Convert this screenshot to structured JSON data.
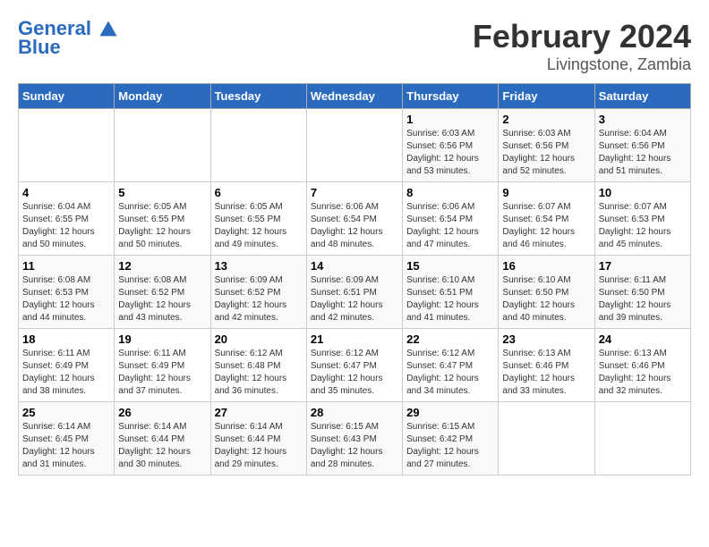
{
  "logo": {
    "line1": "General",
    "line2": "Blue"
  },
  "title": "February 2024",
  "subtitle": "Livingstone, Zambia",
  "header": {
    "days": [
      "Sunday",
      "Monday",
      "Tuesday",
      "Wednesday",
      "Thursday",
      "Friday",
      "Saturday"
    ]
  },
  "weeks": [
    [
      {
        "day": "",
        "sunrise": "",
        "sunset": "",
        "daylight": ""
      },
      {
        "day": "",
        "sunrise": "",
        "sunset": "",
        "daylight": ""
      },
      {
        "day": "",
        "sunrise": "",
        "sunset": "",
        "daylight": ""
      },
      {
        "day": "",
        "sunrise": "",
        "sunset": "",
        "daylight": ""
      },
      {
        "day": "1",
        "sunrise": "Sunrise: 6:03 AM",
        "sunset": "Sunset: 6:56 PM",
        "daylight": "Daylight: 12 hours and 53 minutes."
      },
      {
        "day": "2",
        "sunrise": "Sunrise: 6:03 AM",
        "sunset": "Sunset: 6:56 PM",
        "daylight": "Daylight: 12 hours and 52 minutes."
      },
      {
        "day": "3",
        "sunrise": "Sunrise: 6:04 AM",
        "sunset": "Sunset: 6:56 PM",
        "daylight": "Daylight: 12 hours and 51 minutes."
      }
    ],
    [
      {
        "day": "4",
        "sunrise": "Sunrise: 6:04 AM",
        "sunset": "Sunset: 6:55 PM",
        "daylight": "Daylight: 12 hours and 50 minutes."
      },
      {
        "day": "5",
        "sunrise": "Sunrise: 6:05 AM",
        "sunset": "Sunset: 6:55 PM",
        "daylight": "Daylight: 12 hours and 50 minutes."
      },
      {
        "day": "6",
        "sunrise": "Sunrise: 6:05 AM",
        "sunset": "Sunset: 6:55 PM",
        "daylight": "Daylight: 12 hours and 49 minutes."
      },
      {
        "day": "7",
        "sunrise": "Sunrise: 6:06 AM",
        "sunset": "Sunset: 6:54 PM",
        "daylight": "Daylight: 12 hours and 48 minutes."
      },
      {
        "day": "8",
        "sunrise": "Sunrise: 6:06 AM",
        "sunset": "Sunset: 6:54 PM",
        "daylight": "Daylight: 12 hours and 47 minutes."
      },
      {
        "day": "9",
        "sunrise": "Sunrise: 6:07 AM",
        "sunset": "Sunset: 6:54 PM",
        "daylight": "Daylight: 12 hours and 46 minutes."
      },
      {
        "day": "10",
        "sunrise": "Sunrise: 6:07 AM",
        "sunset": "Sunset: 6:53 PM",
        "daylight": "Daylight: 12 hours and 45 minutes."
      }
    ],
    [
      {
        "day": "11",
        "sunrise": "Sunrise: 6:08 AM",
        "sunset": "Sunset: 6:53 PM",
        "daylight": "Daylight: 12 hours and 44 minutes."
      },
      {
        "day": "12",
        "sunrise": "Sunrise: 6:08 AM",
        "sunset": "Sunset: 6:52 PM",
        "daylight": "Daylight: 12 hours and 43 minutes."
      },
      {
        "day": "13",
        "sunrise": "Sunrise: 6:09 AM",
        "sunset": "Sunset: 6:52 PM",
        "daylight": "Daylight: 12 hours and 42 minutes."
      },
      {
        "day": "14",
        "sunrise": "Sunrise: 6:09 AM",
        "sunset": "Sunset: 6:51 PM",
        "daylight": "Daylight: 12 hours and 42 minutes."
      },
      {
        "day": "15",
        "sunrise": "Sunrise: 6:10 AM",
        "sunset": "Sunset: 6:51 PM",
        "daylight": "Daylight: 12 hours and 41 minutes."
      },
      {
        "day": "16",
        "sunrise": "Sunrise: 6:10 AM",
        "sunset": "Sunset: 6:50 PM",
        "daylight": "Daylight: 12 hours and 40 minutes."
      },
      {
        "day": "17",
        "sunrise": "Sunrise: 6:11 AM",
        "sunset": "Sunset: 6:50 PM",
        "daylight": "Daylight: 12 hours and 39 minutes."
      }
    ],
    [
      {
        "day": "18",
        "sunrise": "Sunrise: 6:11 AM",
        "sunset": "Sunset: 6:49 PM",
        "daylight": "Daylight: 12 hours and 38 minutes."
      },
      {
        "day": "19",
        "sunrise": "Sunrise: 6:11 AM",
        "sunset": "Sunset: 6:49 PM",
        "daylight": "Daylight: 12 hours and 37 minutes."
      },
      {
        "day": "20",
        "sunrise": "Sunrise: 6:12 AM",
        "sunset": "Sunset: 6:48 PM",
        "daylight": "Daylight: 12 hours and 36 minutes."
      },
      {
        "day": "21",
        "sunrise": "Sunrise: 6:12 AM",
        "sunset": "Sunset: 6:47 PM",
        "daylight": "Daylight: 12 hours and 35 minutes."
      },
      {
        "day": "22",
        "sunrise": "Sunrise: 6:12 AM",
        "sunset": "Sunset: 6:47 PM",
        "daylight": "Daylight: 12 hours and 34 minutes."
      },
      {
        "day": "23",
        "sunrise": "Sunrise: 6:13 AM",
        "sunset": "Sunset: 6:46 PM",
        "daylight": "Daylight: 12 hours and 33 minutes."
      },
      {
        "day": "24",
        "sunrise": "Sunrise: 6:13 AM",
        "sunset": "Sunset: 6:46 PM",
        "daylight": "Daylight: 12 hours and 32 minutes."
      }
    ],
    [
      {
        "day": "25",
        "sunrise": "Sunrise: 6:14 AM",
        "sunset": "Sunset: 6:45 PM",
        "daylight": "Daylight: 12 hours and 31 minutes."
      },
      {
        "day": "26",
        "sunrise": "Sunrise: 6:14 AM",
        "sunset": "Sunset: 6:44 PM",
        "daylight": "Daylight: 12 hours and 30 minutes."
      },
      {
        "day": "27",
        "sunrise": "Sunrise: 6:14 AM",
        "sunset": "Sunset: 6:44 PM",
        "daylight": "Daylight: 12 hours and 29 minutes."
      },
      {
        "day": "28",
        "sunrise": "Sunrise: 6:15 AM",
        "sunset": "Sunset: 6:43 PM",
        "daylight": "Daylight: 12 hours and 28 minutes."
      },
      {
        "day": "29",
        "sunrise": "Sunrise: 6:15 AM",
        "sunset": "Sunset: 6:42 PM",
        "daylight": "Daylight: 12 hours and 27 minutes."
      },
      {
        "day": "",
        "sunrise": "",
        "sunset": "",
        "daylight": ""
      },
      {
        "day": "",
        "sunrise": "",
        "sunset": "",
        "daylight": ""
      }
    ]
  ]
}
